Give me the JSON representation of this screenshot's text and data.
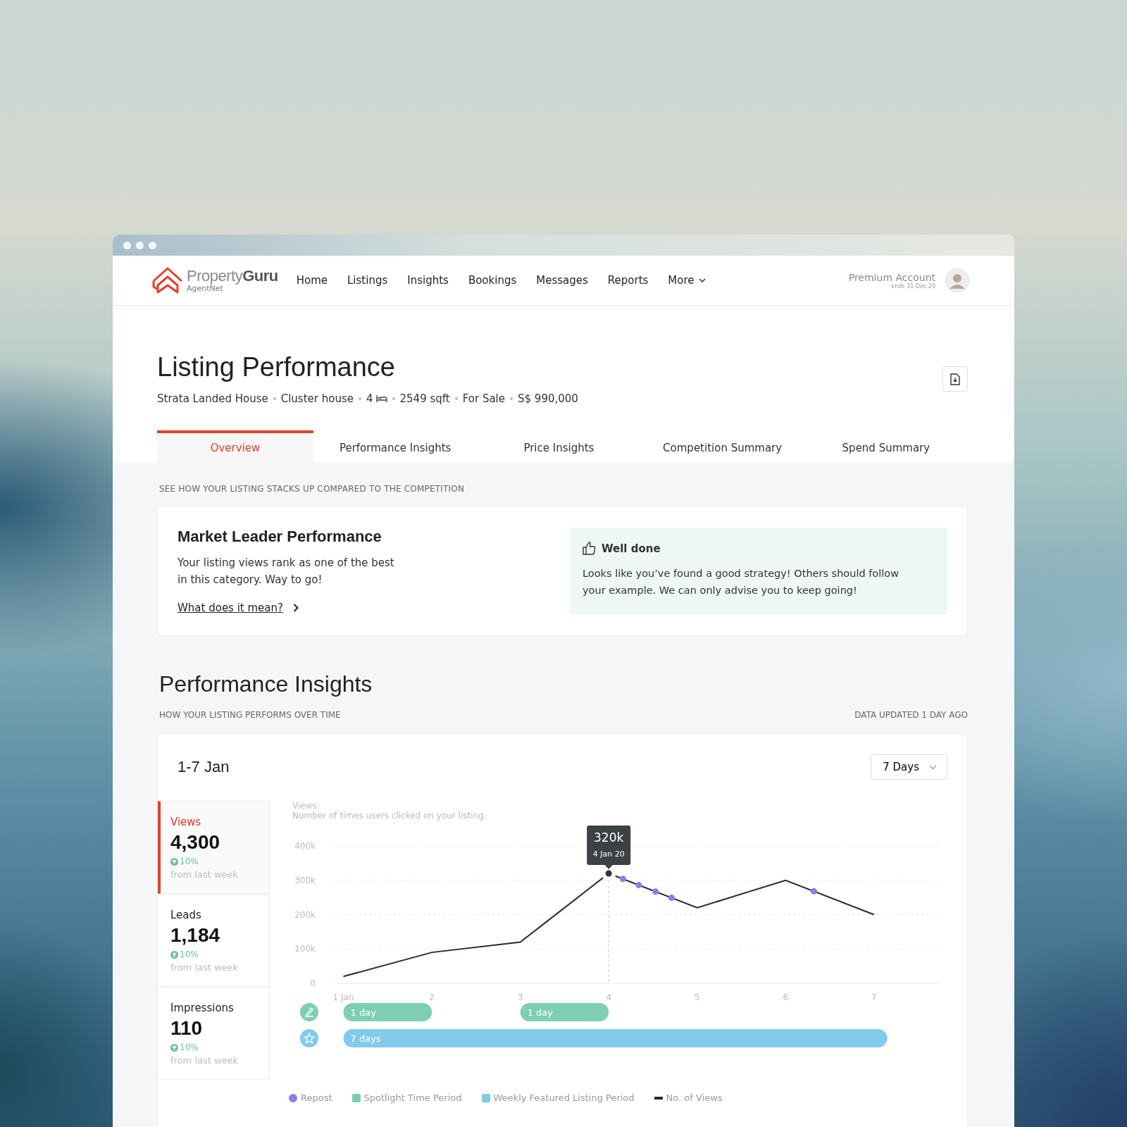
{
  "nav": {
    "logo": {
      "brand": "Property**Guru**",
      "sub": "AgentNet"
    },
    "items": [
      {
        "label": "Home",
        "dropdown": false
      },
      {
        "label": "Listings",
        "dropdown": false
      },
      {
        "label": "Insights",
        "dropdown": false
      },
      {
        "label": "Bookings",
        "dropdown": false
      },
      {
        "label": "Messages",
        "dropdown": false
      },
      {
        "label": "Reports",
        "dropdown": false
      },
      {
        "label": "More",
        "dropdown": true
      }
    ],
    "account": {
      "title": "Premium Account",
      "subtitle": "ends 31 Dec 20"
    }
  },
  "listing": {
    "title": "Listing Performance",
    "meta": [
      {
        "text": "Strata Landed House",
        "kind": "plain"
      },
      {
        "text": "Cluster house",
        "kind": "plain"
      },
      {
        "text": "4",
        "kind": "bedrooms"
      },
      {
        "text": "2549 sqft",
        "kind": "plain"
      },
      {
        "text": "For Sale",
        "kind": "plain"
      },
      {
        "text": "S$ 990,000",
        "kind": "plain"
      }
    ]
  },
  "tabs": [
    {
      "label": "Overview",
      "selected": true
    },
    {
      "label": "Performance Insights",
      "selected": false
    },
    {
      "label": "Price Insights",
      "selected": false
    },
    {
      "label": "Competition Summary",
      "selected": false
    },
    {
      "label": "Spend Summary",
      "selected": false
    }
  ],
  "overview": {
    "caption": "SEE HOW YOUR LISTING STACKS UP COMPARED TO THE COMPETITION",
    "title": "Market Leader Performance",
    "body": "Your listing views rank as one of the best in this category. Way to go!",
    "link": "What does it mean?",
    "tip": {
      "title": "Well done",
      "body": "Looks like you’ve found a good strategy! Others should follow your example. We can only advise you to keep going!"
    }
  },
  "performance": {
    "title": "Performance Insights",
    "subtitle": "HOW YOUR LISTING PERFORMS OVER TIME",
    "updated": "DATA UPDATED 1 DAY AGO",
    "range": "1-7 Jan",
    "period_select": "7 Days",
    "stats": [
      {
        "label": "Views",
        "value": "4,300",
        "change": "10%",
        "note": "from last week",
        "selected": true
      },
      {
        "label": "Leads",
        "value": "1,184",
        "change": "10%",
        "note": "from last week",
        "selected": false
      },
      {
        "label": "Impressions",
        "value": "110",
        "change": "10%",
        "note": "from last week",
        "selected": false
      }
    ],
    "chart_title": "Views:",
    "chart_description": "Number of times users clicked on your listing.",
    "chart_data": {
      "type": "line",
      "x": [
        1,
        2,
        3,
        4,
        5,
        6,
        7
      ],
      "xlim": [
        0.9,
        7.75
      ],
      "xticks": [
        {
          "value": 1,
          "label": "1 Jan"
        },
        2,
        3,
        4,
        5,
        6,
        7
      ],
      "ylim": [
        0,
        400000
      ],
      "yticks": [
        {
          "value": 0,
          "label": "0"
        },
        {
          "value": 100000,
          "label": "100k"
        },
        {
          "value": 200000,
          "label": "200k"
        },
        {
          "value": 300000,
          "label": "300k"
        },
        {
          "value": 400000,
          "label": "400k"
        }
      ],
      "series": [
        {
          "name": "No. of Views",
          "color": "#222b36",
          "values": [
            20000,
            90000,
            120000,
            320000,
            220000,
            300000,
            200000
          ]
        }
      ],
      "grid": true,
      "ref_lines": [
        {
          "axis": "x",
          "value": 4
        }
      ]
    },
    "tooltip": {
      "value": "320k",
      "date": "4 Jan 20"
    },
    "periods": [
      {
        "kind": "spotlight",
        "color": "#7dcfb0",
        "bars": [
          {
            "label": "1 day"
          },
          {
            "label": "1 day"
          }
        ]
      },
      {
        "kind": "featured",
        "color": "#80cbea",
        "bars": [
          {
            "label": "7 days"
          }
        ]
      }
    ],
    "legend": [
      {
        "label": "Repost",
        "kind": "dot",
        "color": "#8b7cf0"
      },
      {
        "label": "Spotlight Time Period",
        "kind": "square",
        "color": "#7dcfb0"
      },
      {
        "label": "Weekly Featured Listing Period",
        "kind": "square",
        "color": "#80cbea"
      }
    ]
  }
}
